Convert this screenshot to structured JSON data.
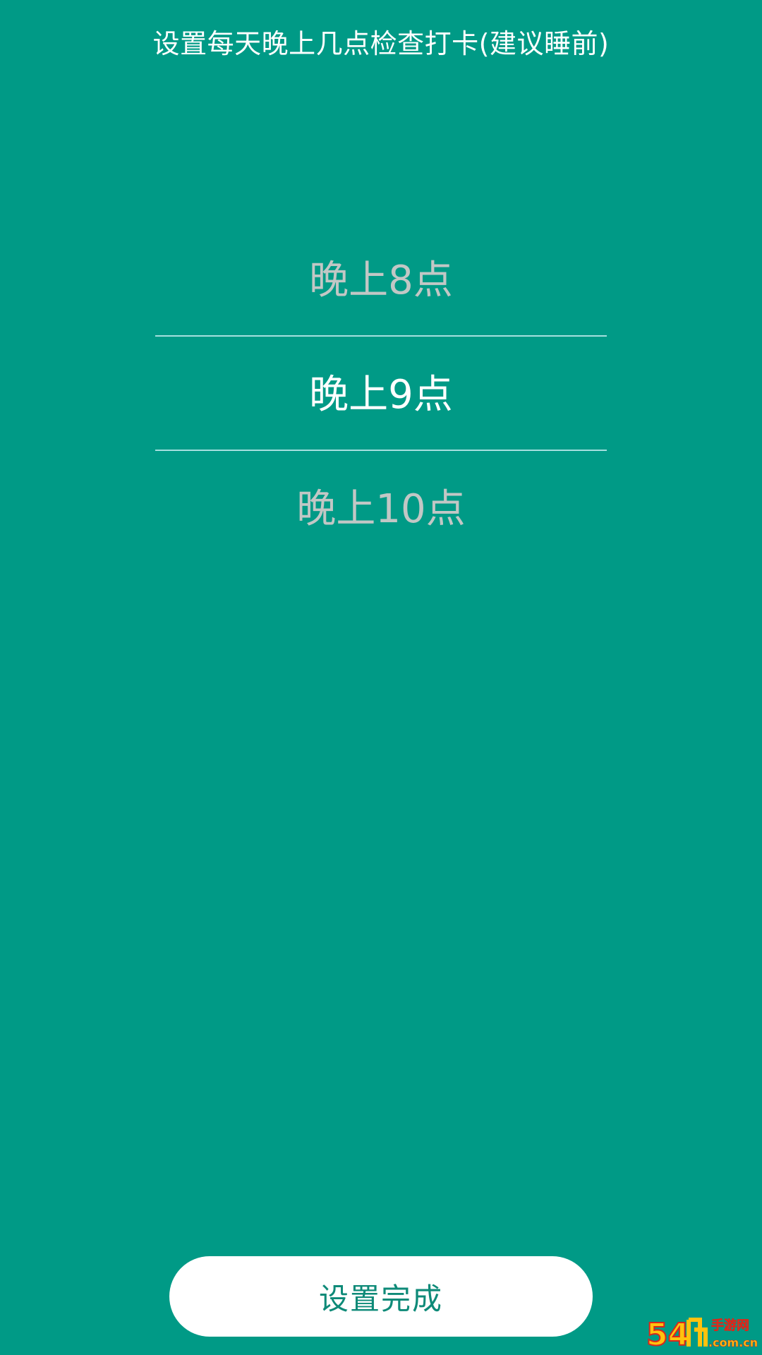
{
  "header": {
    "title": "设置每天晚上几点检查打卡(建议睡前)"
  },
  "picker": {
    "options": [
      "晚上8点",
      "晚上9点",
      "晚上10点"
    ],
    "selected_index": 1
  },
  "footer": {
    "done_label": "设置完成"
  },
  "watermark": {
    "text_large": "54",
    "text_small_top": "手游网",
    "text_small_bottom": ".com.cn"
  },
  "colors": {
    "background": "#009a86",
    "divider": "#a5e0df",
    "unselected_text": "#c2c7c5",
    "selected_text": "#ffffff",
    "button_bg": "#ffffff",
    "button_text": "#0e8a78"
  }
}
